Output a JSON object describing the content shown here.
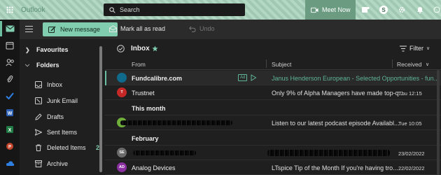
{
  "header": {
    "app_name": "Outlook",
    "search_placeholder": "Search",
    "meet_now_label": "Meet Now"
  },
  "toolbar": {
    "new_message_label": "New message",
    "mark_all_read_label": "Mark all as read",
    "undo_label": "Undo"
  },
  "folders": {
    "favourites_label": "Favourites",
    "folders_label": "Folders",
    "items": [
      {
        "label": "Inbox",
        "icon": "inbox-icon",
        "count": ""
      },
      {
        "label": "Junk Email",
        "icon": "junk-icon",
        "count": ""
      },
      {
        "label": "Drafts",
        "icon": "pencil-icon",
        "count": ""
      },
      {
        "label": "Sent Items",
        "icon": "send-icon",
        "count": ""
      },
      {
        "label": "Deleted Items",
        "icon": "trash-icon",
        "count": "2"
      },
      {
        "label": "Archive",
        "icon": "archive-icon",
        "count": ""
      }
    ]
  },
  "list": {
    "title": "Inbox",
    "filter_label": "Filter",
    "columns": {
      "from": "From",
      "subject": "Subject",
      "received": "Received"
    },
    "ad_badge": "Ad",
    "groups": [
      "This month",
      "February"
    ],
    "rows": [
      {
        "sender": "Fundcalibre.com",
        "subject": "Janus Henderson European - Selected Opportunities - fun...",
        "time": "",
        "avatar_text": "",
        "avatar_color": "#0f6a8c"
      },
      {
        "sender": "Trustnet",
        "subject": "Only 9% of Alpha Managers have made top-q...",
        "time": "Thu 12:15",
        "avatar_text": "T",
        "avatar_color": "#c62828"
      },
      {
        "sender": "",
        "subject": "Listen to our latest podcast episode   Availabl...",
        "time": "Tue 10:05",
        "avatar_text": "",
        "avatar_color": "#6fae3a"
      },
      {
        "sender": "",
        "subject": "",
        "time": "23/02/2022",
        "avatar_text": "SE",
        "avatar_color": "#6b6b6b"
      },
      {
        "sender": "Analog Devices",
        "subject": "LTspice Tip of the Month   If you're having tro...",
        "time": "22/02/2022",
        "avatar_text": "AD",
        "avatar_color": "#8a2fa0"
      }
    ]
  },
  "colors": {
    "accent": "#80cdb0",
    "header_bg": "#a8d3bc",
    "promo_subject": "#5fb49a"
  }
}
